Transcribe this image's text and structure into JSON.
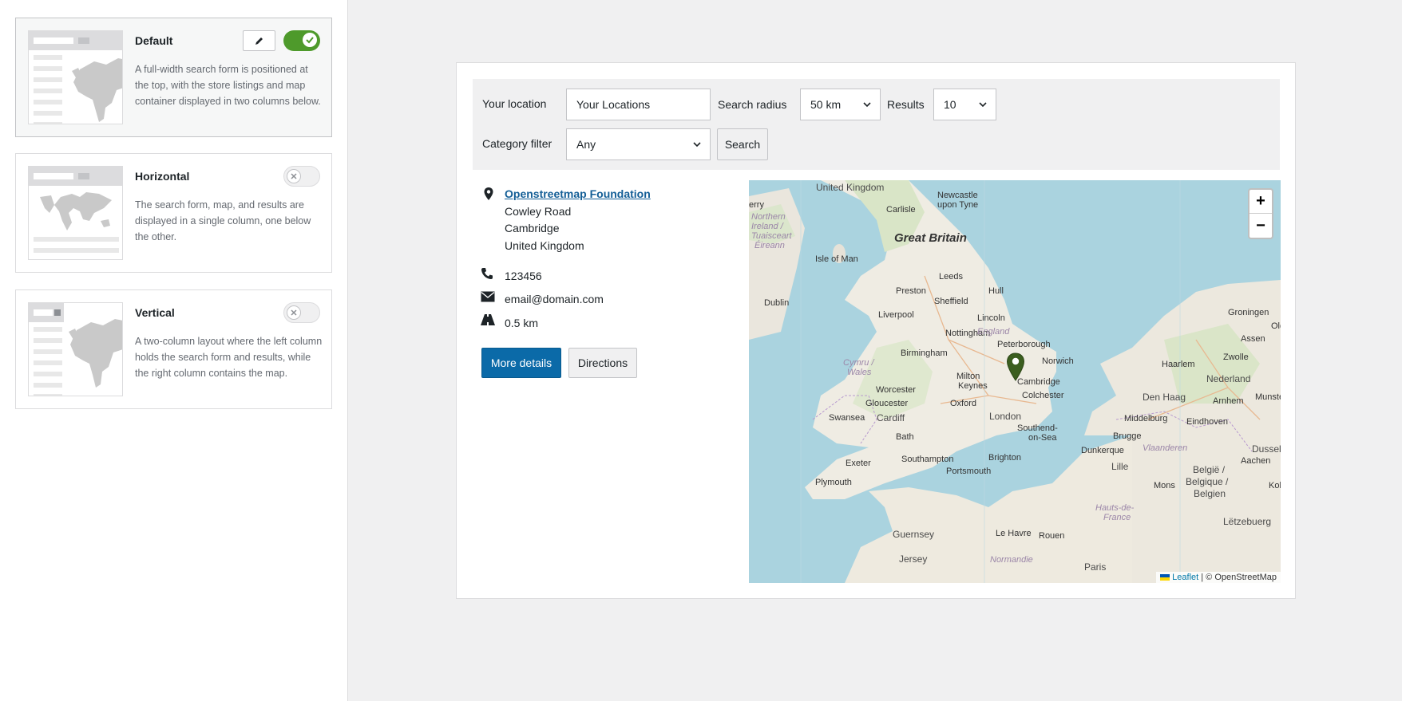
{
  "layouts": [
    {
      "title": "Default",
      "description": "A full-width search form is positioned at the top, with the store listings and map container displayed in two columns below.",
      "enabled": true
    },
    {
      "title": "Horizontal",
      "description": "The search form, map, and results are displayed in a single column, one below the other.",
      "enabled": false
    },
    {
      "title": "Vertical",
      "description": "A two-column layout where the left column holds the search form and results, while the right column contains the map.",
      "enabled": false
    }
  ],
  "search": {
    "location_label": "Your location",
    "location_value": "Your Locations",
    "radius_label": "Search radius",
    "radius_value": "50 km",
    "results_label": "Results",
    "results_value": "10",
    "category_label": "Category filter",
    "category_value": "Any",
    "search_button": "Search"
  },
  "store": {
    "name": "Openstreetmap Foundation",
    "address_line1": "Cowley Road",
    "address_line2": "Cambridge",
    "address_line3": "United Kingdom",
    "phone": "123456",
    "email": "email@domain.com",
    "distance": "0.5 km",
    "more_details_button": "More details",
    "directions_button": "Directions"
  },
  "map": {
    "zoom_in": "+",
    "zoom_out": "−",
    "attribution_leaflet": "Leaflet",
    "attribution_rest": " | © OpenStreetMap",
    "labels": {
      "united_kingdom": "United Kingdom",
      "newcastle": "Newcastle",
      "upon_tyne": "upon Tyne",
      "carlisle": "Carlisle",
      "great_britain": "Great Britain",
      "northern": "Northern",
      "ireland": "Ireland /",
      "tuaisceart": "Tuaisceart",
      "eireann": "Éireann",
      "erry": "erry",
      "isle_of_man": "Isle of Man",
      "leeds": "Leeds",
      "preston": "Preston",
      "hull": "Hull",
      "dublin": "Dublin",
      "sheffield": "Sheffield",
      "liverpool": "Liverpool",
      "lincoln": "Lincoln",
      "nottingham": "Nottingham",
      "england": "England",
      "peterborough": "Peterborough",
      "norwich": "Norwich",
      "birmingham": "Birmingham",
      "cymru": "Cymru /",
      "wales": "Wales",
      "milton": "Milton",
      "keynes": "Keynes",
      "cambridge": "Cambridge",
      "colchester": "Colchester",
      "worcester": "Worcester",
      "gloucester": "Gloucester",
      "oxford": "Oxford",
      "swansea": "Swansea",
      "cardiff": "Cardiff",
      "london": "London",
      "southend": "Southend-",
      "on_sea": "on-Sea",
      "bath": "Bath",
      "exeter": "Exeter",
      "southampton": "Southampton",
      "brighton": "Brighton",
      "portsmouth": "Portsmouth",
      "plymouth": "Plymouth",
      "guernsey": "Guernsey",
      "jersey": "Jersey",
      "le_havre": "Le Havre",
      "rouen": "Rouen",
      "normandie": "Normandie",
      "paris": "Paris",
      "groningen": "Groningen",
      "assen": "Assen",
      "olde": "Old",
      "haarlem": "Haarlem",
      "zwolle": "Zwolle",
      "nederland": "Nederland",
      "den_haag": "Den Haag",
      "arnhem": "Arnhem",
      "munste": "Munste",
      "middelburg": "Middelburg",
      "eindhoven": "Eindhoven",
      "brugge": "Brugge",
      "vlaanderen": "Vlaanderen",
      "dusseldorf": "Dusseldor",
      "dunkerque": "Dunkerque",
      "aachen": "Aachen",
      "lille": "Lille",
      "mons": "Mons",
      "belgie": "België /",
      "belgique": "Belgique /",
      "belgien": "Belgien",
      "kol": "Kol",
      "hauts_de": "Hauts-de-",
      "france": "France",
      "letzebuerg": "Lëtzebuerg"
    }
  },
  "colors": {
    "toggle_on": "#4e9a2b",
    "primary_button": "#0b6aa8",
    "link": "#135e96",
    "sea": "#aad3df",
    "land": "#f2efe9",
    "marker": "#3b5e1f"
  }
}
